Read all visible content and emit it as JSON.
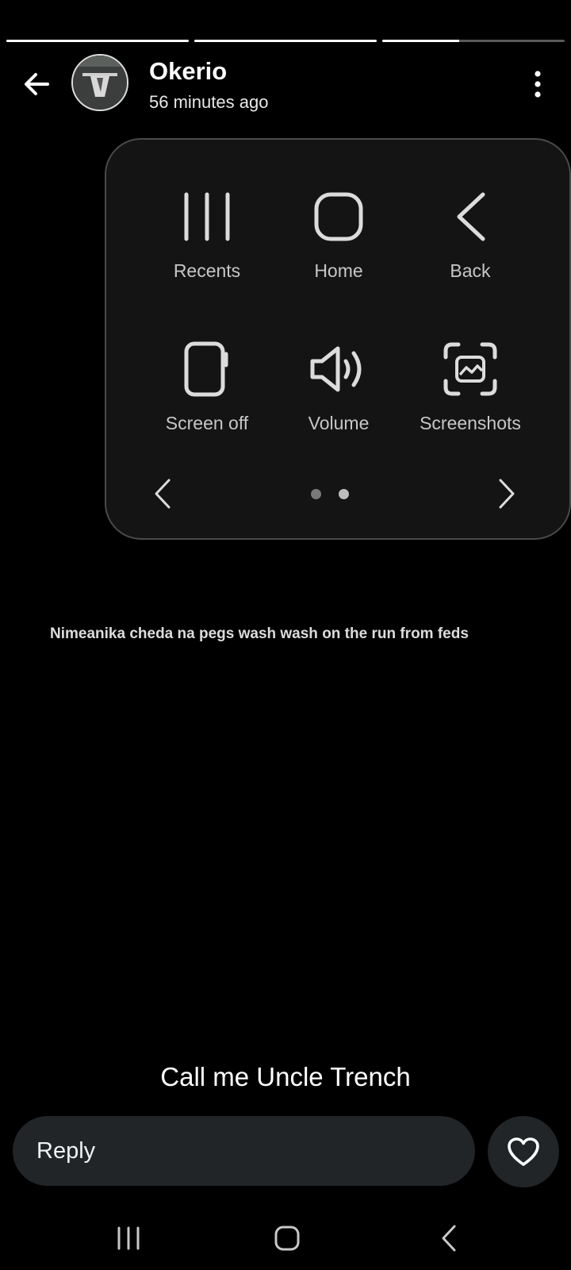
{
  "story": {
    "progress": [
      1,
      1,
      0.42
    ],
    "user_name": "Okerio",
    "time_ago": "56 minutes ago",
    "caption": "Nimeanika cheda na pegs wash wash on the run from feds",
    "text": "Call me Uncle Trench"
  },
  "assistant_menu": {
    "items": [
      {
        "label": "Recents",
        "icon": "recents-icon"
      },
      {
        "label": "Home",
        "icon": "home-icon"
      },
      {
        "label": "Back",
        "icon": "back-icon"
      },
      {
        "label": "Screen off",
        "icon": "screen-off-icon"
      },
      {
        "label": "Volume",
        "icon": "volume-icon"
      },
      {
        "label": "Screenshots",
        "icon": "screenshot-icon"
      }
    ],
    "pages": 2,
    "current_page": 2
  },
  "reply": {
    "placeholder": "Reply"
  },
  "colors": {
    "background": "#000000",
    "panel": "#141414",
    "input": "#212528",
    "icon": "#dcdcdc"
  }
}
